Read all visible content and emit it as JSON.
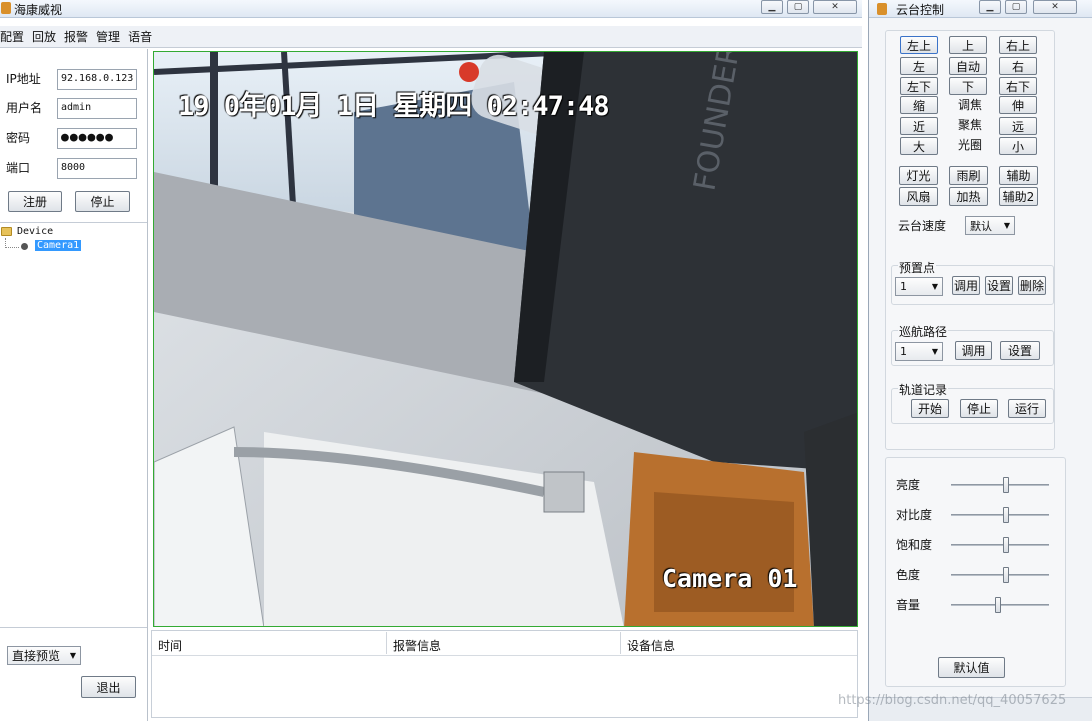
{
  "main_window": {
    "title": "海康威视",
    "menu": [
      "配置",
      "回放",
      "报警",
      "管理",
      "语音"
    ]
  },
  "login": {
    "ip_label": "IP地址",
    "ip_value": "92.168.0.123",
    "user_label": "用户名",
    "user_value": "admin",
    "pwd_label": "密码",
    "pwd_value": "●●●●●●",
    "port_label": "端口",
    "port_value": "8000",
    "register_button": "注册",
    "stop_button": "停止"
  },
  "tree": {
    "root": "Device",
    "child": "Camera1"
  },
  "bottom_left": {
    "preview_mode": "直接预览",
    "exit_button": "退出"
  },
  "video": {
    "timestamp": "19 0年01月 1日 星期四 02:47:48",
    "camera_label": "Camera 01",
    "monitor_brand": "FOUNDER"
  },
  "info_table": {
    "headers": [
      "时间",
      "报警信息",
      "设备信息"
    ]
  },
  "ptz_window": {
    "title": "云台控制",
    "dir": {
      "up_left": "左上",
      "up": "上",
      "up_right": "右上",
      "left": "左",
      "auto": "自动",
      "right": "右",
      "down_left": "左下",
      "down": "下",
      "down_right": "右下"
    },
    "zoom_out": "缩",
    "zoom_in": "伸",
    "zoom_label": "调焦",
    "near": "近",
    "far": "远",
    "focus_label": "聚焦",
    "iris_big": "大",
    "iris_small": "小",
    "iris_label": "光圈",
    "light": "灯光",
    "wiper": "雨刷",
    "aux": "辅助",
    "fan": "风扇",
    "heater": "加热",
    "aux2": "辅助2",
    "speed_label": "云台速度",
    "speed_value": "默认",
    "preset": {
      "label": "预置点",
      "value": "1",
      "call": "调用",
      "set": "设置",
      "delete": "删除"
    },
    "cruise": {
      "label": "巡航路径",
      "value": "1",
      "call": "调用",
      "set": "设置"
    },
    "track": {
      "label": "轨道记录",
      "start": "开始",
      "stop": "停止",
      "run": "运行"
    },
    "video_params": [
      {
        "label": "亮度",
        "level": 0.56
      },
      {
        "label": "对比度",
        "level": 0.56
      },
      {
        "label": "饱和度",
        "level": 0.56
      },
      {
        "label": "色度",
        "level": 0.56
      },
      {
        "label": "音量",
        "level": 0.48
      }
    ],
    "default_button": "默认值"
  },
  "watermark": "https://blog.csdn.net/qq_40057625",
  "colors": {
    "video_border": "#33aa33",
    "title_bar": "#dfe8f3",
    "tree_selection": "#3399ff"
  }
}
